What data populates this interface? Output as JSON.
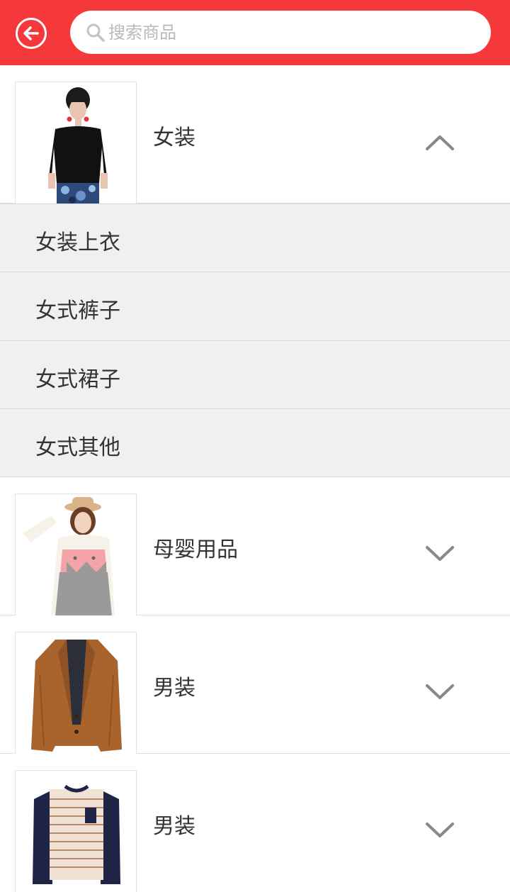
{
  "header": {
    "back_icon": "arrow-left-circle-icon",
    "search": {
      "placeholder": "搜索商品",
      "value": "",
      "icon": "search-icon"
    },
    "accent_color": "#f5383a"
  },
  "categories": [
    {
      "label": "女装",
      "expanded": true,
      "image": "woman-black-blouse-floral-skirt",
      "chevron": "chevron-up-icon",
      "subcategories": [
        "女装上衣",
        "女式裤子",
        "女式裙子",
        "女式其他"
      ]
    },
    {
      "label": "母婴用品",
      "expanded": false,
      "image": "woman-hat-pink-overall",
      "chevron": "chevron-down-icon"
    },
    {
      "label": "男装",
      "expanded": false,
      "image": "brown-blazer",
      "chevron": "chevron-down-icon"
    },
    {
      "label": "男装",
      "expanded": false,
      "image": "striped-long-sleeve-shirt",
      "chevron": "chevron-down-icon"
    }
  ]
}
